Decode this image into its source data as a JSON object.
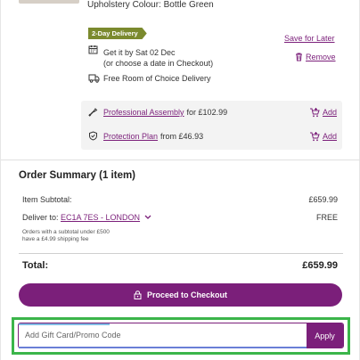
{
  "item": {
    "colour": "Upholstery Colour: Bottle Green",
    "badge": "2-Day Delivery",
    "save_later": "Save for Later",
    "remove": "Remove",
    "get_it_line1": "Get it by Sat 02 Dec",
    "get_it_line2": "(or choose a date in Checkout)",
    "free_delivery": "Free Room of Choice Delivery"
  },
  "addons": [
    {
      "label": "Professional Assembly",
      "price": "for £102.99",
      "action": "Add",
      "icon": "screwdriver-icon"
    },
    {
      "label": "Protection Plan",
      "price": "from £46.93",
      "action": "Add",
      "icon": "shield-icon"
    }
  ],
  "summary": {
    "title": "Order Summary (1 item)",
    "subtotal_label": "Item Subtotal:",
    "subtotal_value": "£659.99",
    "deliver_label": "Deliver to:",
    "deliver_code": "EC1A 7ES - LONDON",
    "deliver_value": "FREE",
    "note_line1": "Orders with a subtotal under £500",
    "note_line2": "have a £4.99 shipping fee",
    "total_label": "Total:",
    "total_value": "£659.99"
  },
  "checkout": {
    "label": "Proceed to Checkout"
  },
  "promo": {
    "placeholder": "Add Gift Card/Promo Code",
    "apply": "Apply"
  },
  "colors": {
    "accent": "#7b1f7a",
    "badge": "#7b8a2e",
    "highlight": "#3bb54a"
  }
}
